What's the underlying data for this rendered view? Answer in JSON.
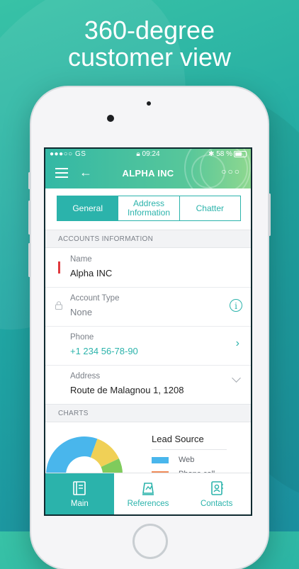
{
  "headline": {
    "line1": "360-degree",
    "line2": "customer view"
  },
  "status_bar": {
    "carrier": "●●●○○ GS",
    "time": "09:24",
    "battery": "58 %"
  },
  "nav": {
    "title": "ALPHA INC"
  },
  "tabs": [
    {
      "label": "General",
      "active": true
    },
    {
      "label": "Address Information",
      "active": false
    },
    {
      "label": "Chatter",
      "active": false
    }
  ],
  "sections": {
    "accounts": "ACCOUNTS INFORMATION",
    "charts": "CHARTS"
  },
  "fields": {
    "name": {
      "label": "Name",
      "value": "Alpha INC"
    },
    "account_type": {
      "label": "Account Type",
      "value": "None"
    },
    "phone": {
      "label": "Phone",
      "value": "+1 234 56-78-90"
    },
    "address": {
      "label": "Address",
      "value": "Route de Malagnou 1, 1208"
    }
  },
  "chart_data": {
    "type": "pie",
    "title": "Lead Source",
    "series": [
      {
        "name": "Web",
        "color": "#49b6ec"
      },
      {
        "name": "Phone call",
        "color": "#f08c5a"
      }
    ],
    "slice_colors": [
      "#49b6ec",
      "#f0d056",
      "#7fcb5c",
      "#f08c5a"
    ]
  },
  "bottom_nav": [
    {
      "label": "Main",
      "icon": "book-icon",
      "active": true
    },
    {
      "label": "References",
      "icon": "chart-icon",
      "active": false
    },
    {
      "label": "Contacts",
      "icon": "contacts-icon",
      "active": false
    }
  ],
  "colors": {
    "accent": "#2bb3ab",
    "required": "#e0393e"
  }
}
